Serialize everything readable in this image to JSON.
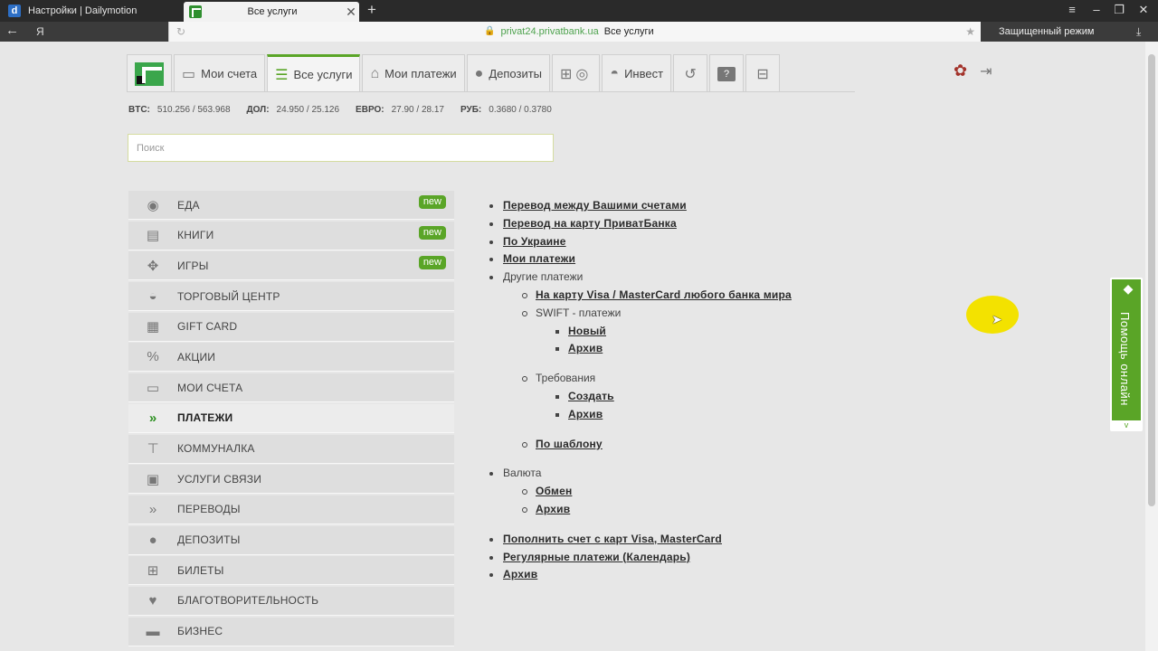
{
  "browser": {
    "tabs": [
      {
        "favicon": "d",
        "title": "Настройки | Dailymotion"
      },
      {
        "title": "Все услуги",
        "close": "✕"
      }
    ],
    "new_tab": "+",
    "address": {
      "search_engine": "Я",
      "domain": "privat24.privatbank.ua",
      "page_title": "Все услуги",
      "mode": "Защищенный режим"
    }
  },
  "topnav": {
    "items": [
      {
        "label": "Мои счета",
        "icon": "card-icon"
      },
      {
        "label": "Все услуги",
        "icon": "menu-lines-icon"
      },
      {
        "label": "Мои платежи",
        "icon": "house-icon"
      },
      {
        "label": "Депозиты",
        "icon": "piggy-bank-icon"
      },
      {
        "label": "",
        "icon": "tickets-icon"
      },
      {
        "label": "Инвест",
        "icon": "money-bag-icon"
      },
      {
        "label": "",
        "icon": "history-icon"
      },
      {
        "label": "?",
        "icon": "help-icon"
      },
      {
        "label": "",
        "icon": "cart-icon"
      }
    ]
  },
  "rates": [
    {
      "name": "BTC:",
      "value": "510.256 / 563.968"
    },
    {
      "name": "ДОЛ:",
      "value": "24.950 / 25.126"
    },
    {
      "name": "ЕВРО:",
      "value": "27.90 / 28.17"
    },
    {
      "name": "РУБ:",
      "value": "0.3680 / 0.3780"
    }
  ],
  "search": {
    "placeholder": "Поиск"
  },
  "sidebar": {
    "items": [
      {
        "label": "Еда",
        "badge": "new"
      },
      {
        "label": "Книги",
        "badge": "new"
      },
      {
        "label": "Игры",
        "badge": "new"
      },
      {
        "label": "Торговый центр"
      },
      {
        "label": "Gift Card"
      },
      {
        "label": "Акции"
      },
      {
        "label": "Мои счета"
      },
      {
        "label": "Платежи",
        "active": true
      },
      {
        "label": "Коммуналка"
      },
      {
        "label": "Услуги связи"
      },
      {
        "label": "Переводы"
      },
      {
        "label": "Депозиты"
      },
      {
        "label": "Билеты"
      },
      {
        "label": "Благотворительность"
      },
      {
        "label": "Бизнес"
      }
    ]
  },
  "content": {
    "transfer_own": "Перевод между Вашими счетами",
    "transfer_card": "Перевод на карту ПриватБанка",
    "ukraine": "По Украине",
    "my_payments": "Мои платежи",
    "other_payments": "Другие платежи",
    "visa_mc_any": "На карту Visa / MasterCard любого банка мира",
    "swift": "SWIFT - платежи",
    "swift_new": "Новый",
    "swift_archive": "Архив",
    "requirements": "Требования",
    "req_create": "Создать",
    "req_archive": "Архив",
    "by_template": "По шаблону",
    "currency": "Валюта",
    "exchange": "Обмен",
    "currency_archive": "Архив",
    "topup": "Пополнить счет с карт Visa, MasterCard",
    "regular": "Регулярные платежи (Календарь)",
    "archive": "Архив"
  },
  "help_widget": {
    "label": "Помощь онлайн"
  },
  "colors": {
    "accent": "#5aa527",
    "logo": "#3aa64b",
    "cursor_highlight": "#f3e200"
  }
}
